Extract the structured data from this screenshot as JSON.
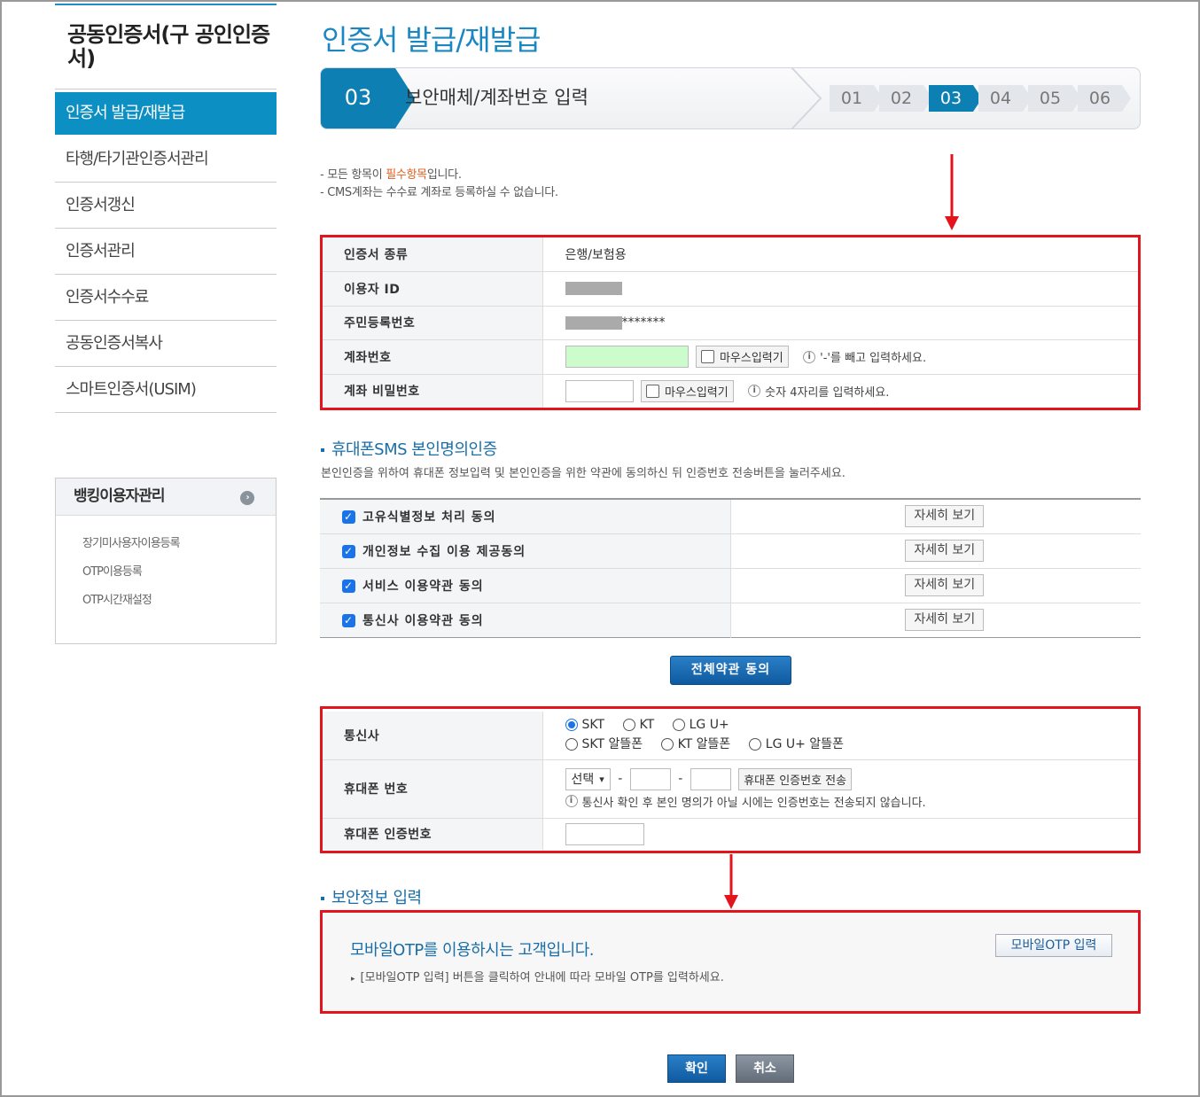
{
  "sidebar": {
    "title": "공동인증서(구 공인인증서)",
    "items": [
      {
        "label": "인증서 발급/재발급"
      },
      {
        "label": "타행/타기관인증서관리"
      },
      {
        "label": "인증서갱신"
      },
      {
        "label": "인증서관리"
      },
      {
        "label": "인증서수수료"
      },
      {
        "label": "공동인증서복사"
      },
      {
        "label": "스마트인증서(USIM)"
      }
    ],
    "bank": {
      "title": "뱅킹이용자관리",
      "items": [
        "장기미사용자이용등록",
        "OTP이용등록",
        "OTP시간재설정"
      ]
    }
  },
  "header": {
    "title": "인증서 발급/재발급",
    "current_step": "03",
    "current_step_name": "보안매체/계좌번호 입력",
    "steps": [
      "01",
      "02",
      "03",
      "04",
      "05",
      "06"
    ]
  },
  "notes": {
    "line1_pre": "- 모든 항목이 ",
    "line1_req": "필수항목",
    "line1_post": "입니다.",
    "line2": "- CMS계좌는 수수료 계좌로 등록하실 수 없습니다."
  },
  "cert_form": {
    "type_label": "인증서 종류",
    "type_value": "은행/보험용",
    "userid_label": "이용자 ID",
    "rrn_label": "주민등록번호",
    "rrn_suffix": "*******",
    "account_label": "계좌번호",
    "account_mouse": "마우스입력기",
    "account_hint": "'-'를 빼고 입력하세요.",
    "pw_label": "계좌 비밀번호",
    "pw_mouse": "마우스입력기",
    "pw_hint": "숫자 4자리를 입력하세요."
  },
  "sms": {
    "title": "휴대폰SMS 본인명의인증",
    "desc": "본인인증을 위하여 휴대폰 정보입력 및 본인인증을 위한 약관에 동의하신 뒤 인증번호 전송버튼을 눌러주세요.",
    "agreements": [
      {
        "label": "고유식별정보 처리 동의",
        "button": "자세히 보기",
        "checked": true
      },
      {
        "label": "개인정보 수집 이용 제공동의",
        "button": "자세히 보기",
        "checked": true
      },
      {
        "label": "서비스 이용약관 동의",
        "button": "자세히 보기",
        "checked": true
      },
      {
        "label": "통신사 이용약관 동의",
        "button": "자세히 보기",
        "checked": true
      }
    ],
    "agree_all": "전체약관 동의"
  },
  "phone_form": {
    "carrier_label": "통신사",
    "carriers_row1": [
      "SKT",
      "KT",
      "LG U+"
    ],
    "carriers_row2": [
      "SKT 알뜰폰",
      "KT 알뜰폰",
      "LG U+ 알뜰폰"
    ],
    "carrier_selected": "SKT",
    "phone_label": "휴대폰 번호",
    "phone_select": "선택",
    "phone_dash": "-",
    "send_button": "휴대폰 인증번호 전송",
    "phone_hint": "통신사 확인 후 본인 명의가 아닐 시에는 인증번호는 전송되지 않습니다.",
    "code_label": "휴대폰 인증번호"
  },
  "security": {
    "title": "보안정보 입력",
    "otp_title": "모바일OTP를 이용하시는 고객입니다.",
    "otp_desc": "[모바일OTP 입력] 버튼을 클릭하여 안내에 따라 모바일 OTP를 입력하세요.",
    "otp_button": "모바일OTP 입력"
  },
  "footer": {
    "ok": "확인",
    "cancel": "취소"
  },
  "colors": {
    "accent": "#0c8fc3",
    "highlight_red": "#e3141b",
    "required": "#e0601f"
  }
}
